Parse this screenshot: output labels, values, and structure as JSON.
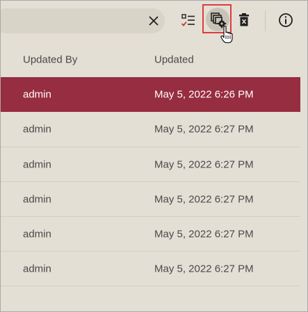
{
  "toolbar": {
    "clear_icon": "close-icon",
    "select_icon": "checklist-icon",
    "manage_icon": "manage-columns-gear-icon",
    "delete_icon": "delete-icon",
    "info_icon": "info-icon",
    "colors": {
      "accent_highlight": "#e03a3e",
      "icon": "#1f1f1f",
      "check_red": "#c0392b"
    }
  },
  "table": {
    "columns": [
      "Updated By",
      "Updated"
    ],
    "rows": [
      {
        "updated_by": "admin",
        "updated": "May 5, 2022 6:26 PM",
        "selected": true
      },
      {
        "updated_by": "admin",
        "updated": "May 5, 2022 6:27 PM",
        "selected": false
      },
      {
        "updated_by": "admin",
        "updated": "May 5, 2022 6:27 PM",
        "selected": false
      },
      {
        "updated_by": "admin",
        "updated": "May 5, 2022 6:27 PM",
        "selected": false
      },
      {
        "updated_by": "admin",
        "updated": "May 5, 2022 6:27 PM",
        "selected": false
      },
      {
        "updated_by": "admin",
        "updated": "May 5, 2022 6:27 PM",
        "selected": false
      }
    ],
    "colors": {
      "selected_row_bg": "#962d40",
      "background": "#e3dfd5"
    }
  }
}
